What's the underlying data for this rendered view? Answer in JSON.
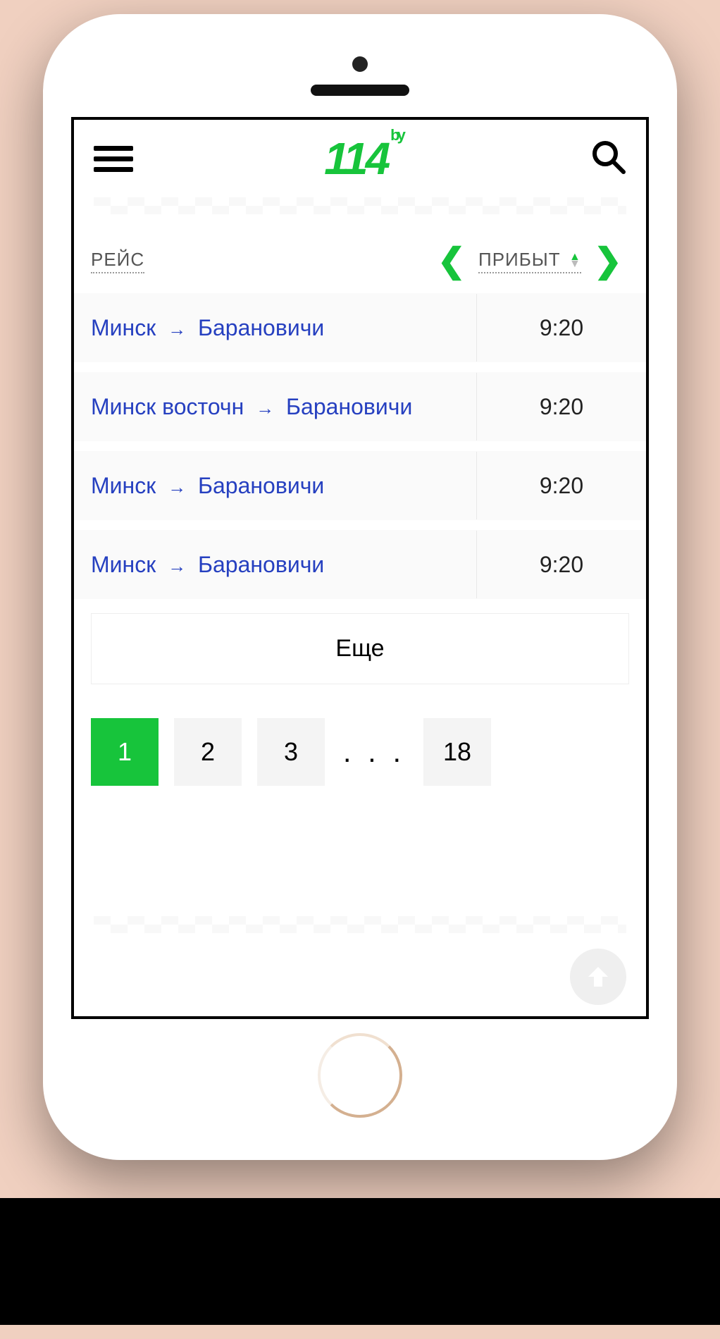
{
  "logo": {
    "text": "114",
    "suffix": "by"
  },
  "columns": {
    "route": "РЕЙС",
    "arrival": "ПРИБЫТ"
  },
  "rows": [
    {
      "from": "Минск",
      "to": "Барановичи",
      "time": "9:20"
    },
    {
      "from": "Минск восточн",
      "to": "Барановичи",
      "time": "9:20"
    },
    {
      "from": "Минск",
      "to": "Барановичи",
      "time": "9:20"
    },
    {
      "from": "Минск",
      "to": "Барановичи",
      "time": "9:20"
    }
  ],
  "more_label": "Еще",
  "pagination": {
    "pages": [
      "1",
      "2",
      "3"
    ],
    "ellipsis": ". . .",
    "last": "18",
    "active": "1"
  }
}
